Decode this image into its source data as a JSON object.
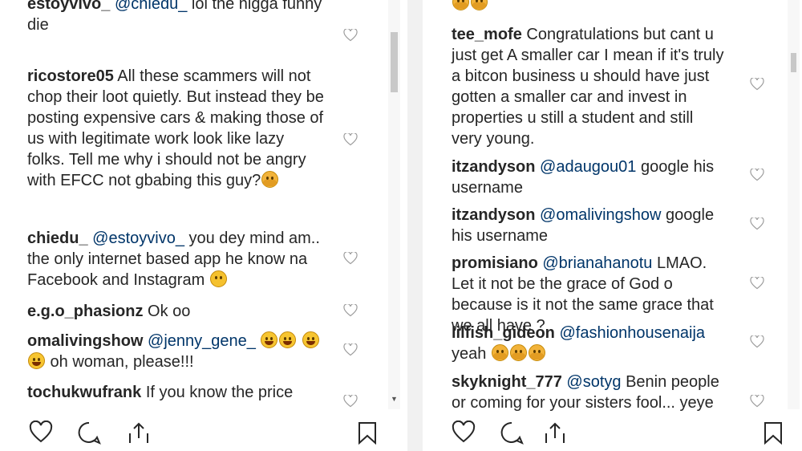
{
  "left_comments": [
    {
      "user": "estoyvivo_",
      "mention": "@chiedu_",
      "text": " lol the nigga funny die",
      "emojis": []
    },
    {
      "user": "ricostore05",
      "mention": "",
      "text": " All these scammers will not chop their loot quietly. But instead they be posting expensive cars & making those of us with legitimate work look like lazy folks. Tell me why i should not be angry with EFCC not gbabing this guy?",
      "emojis": [
        "tired-face-emoji"
      ]
    },
    {
      "user": "chiedu_",
      "mention": "@estoyvivo_",
      "text": " you dey mind am.. the only internet based app he know na Facebook and Instagram",
      "emojis": [
        "eye-roll-emoji"
      ]
    },
    {
      "user": "e.g.o_phasionz",
      "mention": "",
      "text": " Ok oo",
      "emojis": []
    },
    {
      "user": "omalivingshow",
      "mention": "@jenny_gene_",
      "text": " oh woman, please!!!",
      "emojis": [
        "rofl-emoji",
        "rofl-emoji",
        "rofl-emoji",
        "rofl-emoji"
      ]
    },
    {
      "user": "tochukwufrank",
      "mention": "",
      "text": " If you know the price",
      "emojis": []
    }
  ],
  "right_comments": [
    {
      "user": "tee_mofe",
      "mention": "",
      "text": " Congratulations but cant u just get A smaller car I mean if it's truly a bitcon business u should have just gotten a smaller car and invest in properties u still a student and still very young.",
      "emojis": []
    },
    {
      "user": "itzandyson",
      "mention": "@adaugou01",
      "text": " google his username",
      "emojis": []
    },
    {
      "user": "itzandyson",
      "mention": "@omalivingshow",
      "text": " google his username",
      "emojis": []
    },
    {
      "user": "promisiano",
      "mention": "@brianahanotu",
      "text": " LMAO. Let it not be the grace of God o because is it not the same grace that we all have ?",
      "emojis": []
    },
    {
      "user": "lilfish_gideon",
      "mention": "@fashionhousenaija",
      "text": " yeah",
      "emojis": [
        "scream-emoji",
        "scream-emoji",
        "scream-emoji"
      ]
    },
    {
      "user": "skyknight_777",
      "mention": "@sotyg",
      "text": " Benin people or coming for your sisters fool... yeye",
      "emojis": []
    }
  ],
  "icons": {
    "like": "heart-icon",
    "comment": "comment-icon",
    "share": "share-icon",
    "save": "bookmark-icon"
  },
  "colors": {
    "username": "#262626",
    "mention": "#003569",
    "icon": "#999999"
  }
}
